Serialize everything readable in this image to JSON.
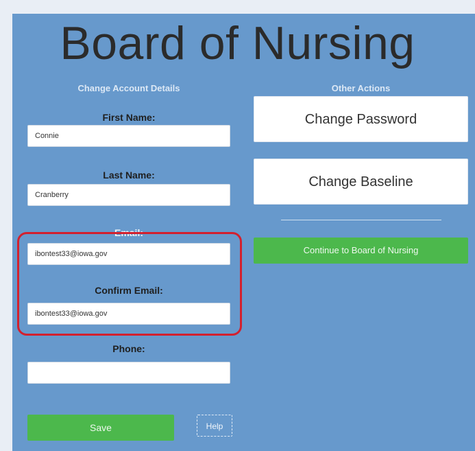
{
  "page": {
    "title": "Board of Nursing"
  },
  "account_details": {
    "heading": "Change Account Details",
    "first_name": {
      "label": "First Name:",
      "value": "Connie"
    },
    "last_name": {
      "label": "Last Name:",
      "value": "Cranberry"
    },
    "email": {
      "label": "Email:",
      "value": "ibontest33@iowa.gov"
    },
    "confirm_email": {
      "label": "Confirm Email:",
      "value": "ibontest33@iowa.gov"
    },
    "phone": {
      "label": "Phone:",
      "value": ""
    },
    "save_label": "Save",
    "help_label": "Help"
  },
  "other_actions": {
    "heading": "Other Actions",
    "change_password_label": "Change Password",
    "change_baseline_label": "Change Baseline",
    "continue_label": "Continue to Board of Nursing"
  },
  "colors": {
    "panel_bg": "#6799cc",
    "accent_green": "#4cb84c",
    "highlight_red": "#d3202e"
  }
}
